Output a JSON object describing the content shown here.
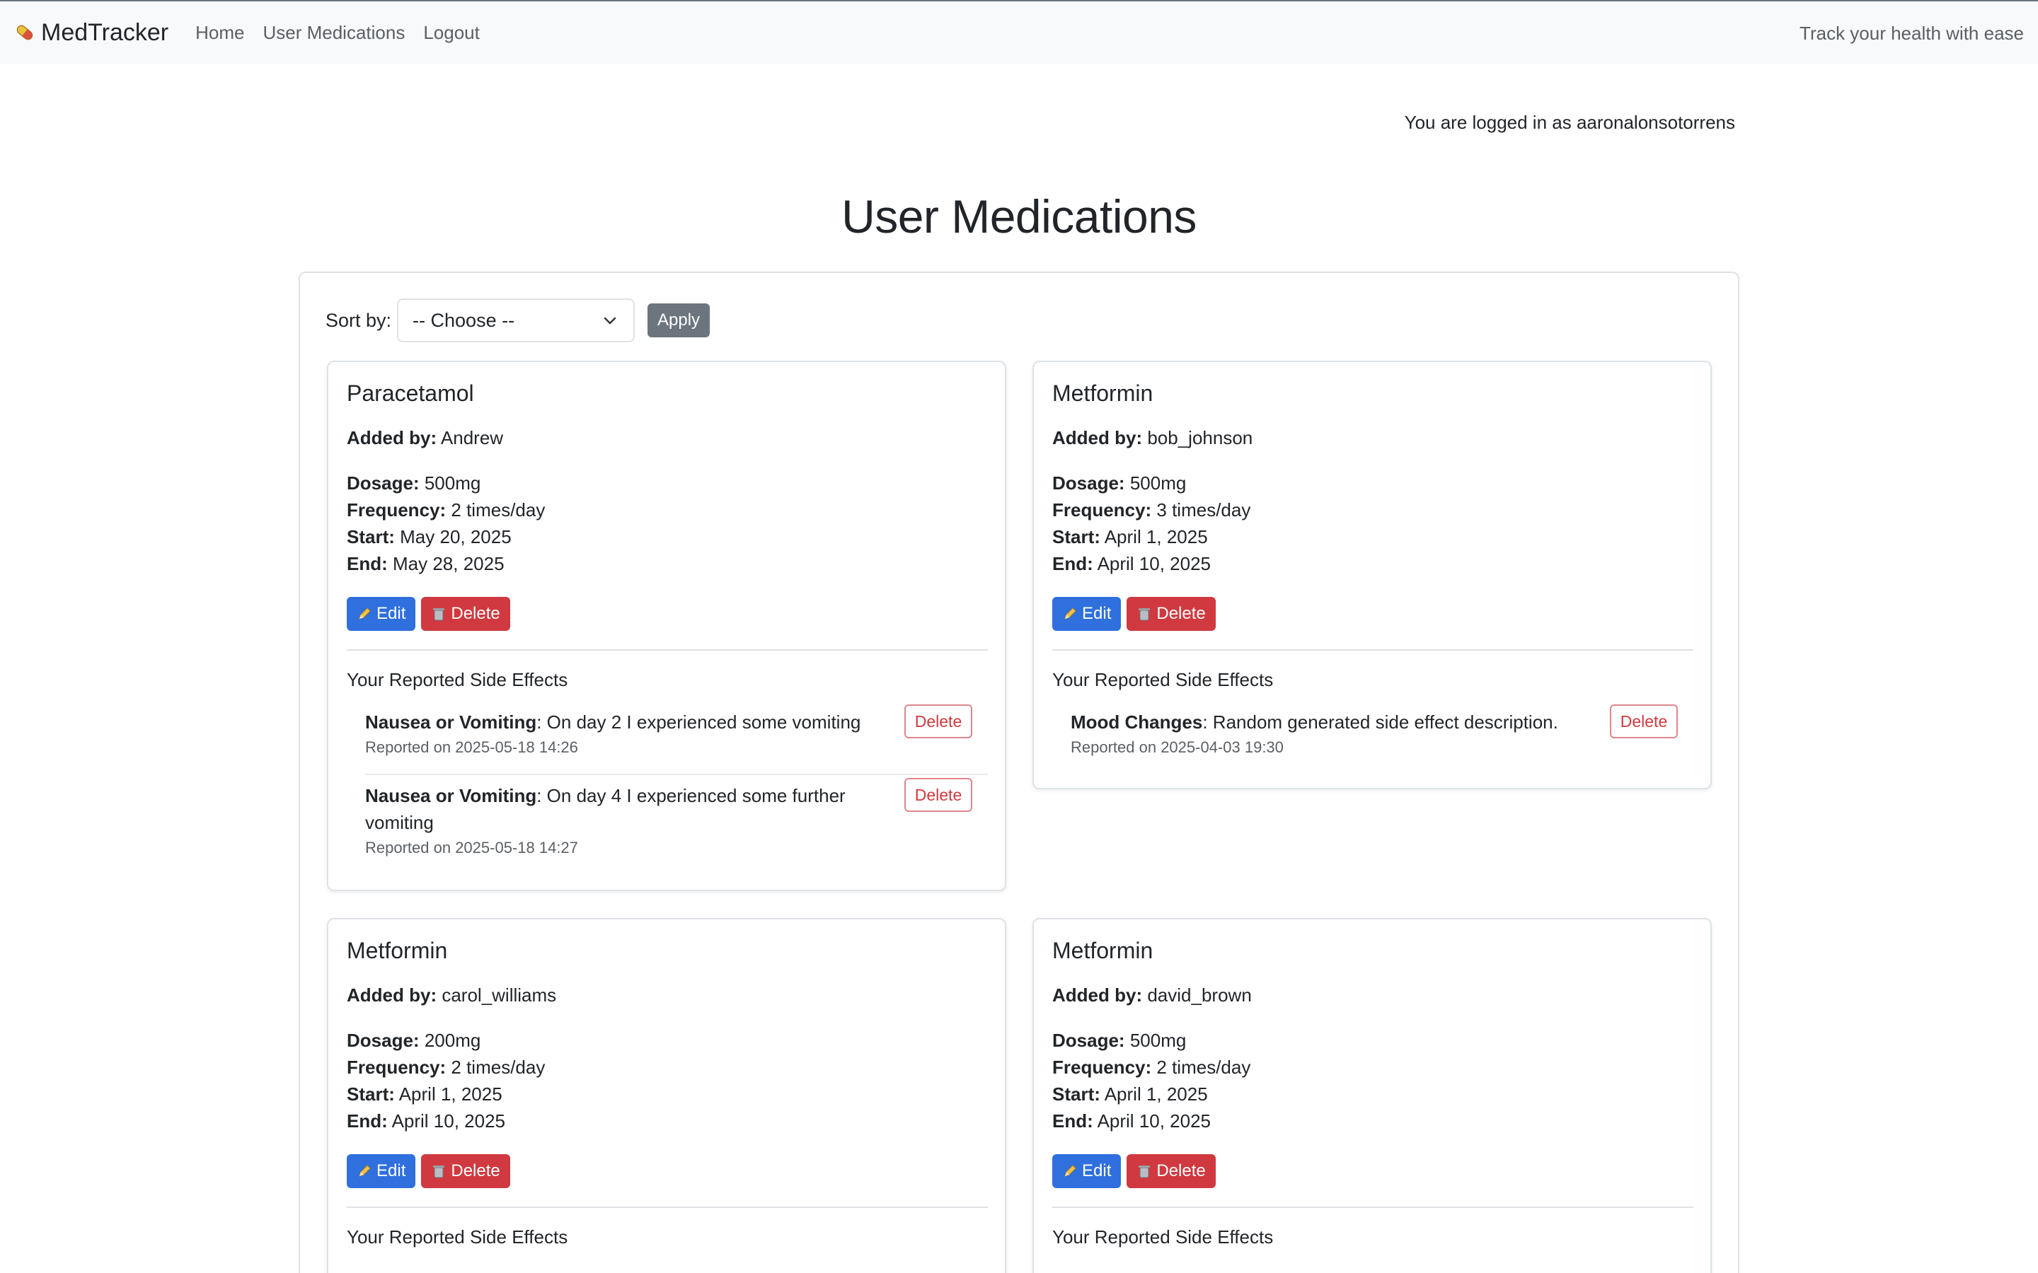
{
  "navbar": {
    "brand": "MedTracker",
    "links": [
      "Home",
      "User Medications",
      "Logout"
    ],
    "tagline": "Track your health with ease"
  },
  "login_info": "You are logged in as aaronalonsotorrens",
  "page_title": "User Medications",
  "sort": {
    "label": "Sort by:",
    "selected": "-- Choose --",
    "apply_label": "Apply"
  },
  "labels": {
    "added_by": "Added by:",
    "dosage": "Dosage:",
    "frequency": "Frequency:",
    "start": "Start:",
    "end": "End:",
    "edit": "Edit",
    "delete": "Delete",
    "side_effects_title": "Your Reported Side Effects",
    "se_delete": "Delete"
  },
  "colors": {
    "edit_button": "#2f6fde",
    "delete_button": "#d0393f",
    "apply_button": "#6c757d"
  },
  "icons": {
    "brand": "pill-icon",
    "edit": "pencil-icon",
    "delete": "trash-icon",
    "select": "chevron-down-icon"
  },
  "medications": [
    {
      "name": "Paracetamol",
      "added_by": "Andrew",
      "dosage": "500mg",
      "frequency": "2 times/day",
      "start": "May 20, 2025",
      "end": "May 28, 2025",
      "side_effects": [
        {
          "type": "Nausea or Vomiting",
          "text": ": On day 2 I experienced some vomiting",
          "date": "Reported on 2025-05-18 14:26"
        },
        {
          "type": "Nausea or Vomiting",
          "text": ": On day 4 I experienced some further vomiting",
          "date": "Reported on 2025-05-18 14:27"
        }
      ]
    },
    {
      "name": "Metformin",
      "added_by": "bob_johnson",
      "dosage": "500mg",
      "frequency": "3 times/day",
      "start": "April 1, 2025",
      "end": "April 10, 2025",
      "side_effects": [
        {
          "type": "Mood Changes",
          "text": ": Random generated side effect description.",
          "date": "Reported on 2025-04-03 19:30"
        }
      ]
    },
    {
      "name": "Metformin",
      "added_by": "carol_williams",
      "dosage": "200mg",
      "frequency": "2 times/day",
      "start": "April 1, 2025",
      "end": "April 10, 2025",
      "side_effects": []
    },
    {
      "name": "Metformin",
      "added_by": "david_brown",
      "dosage": "500mg",
      "frequency": "2 times/day",
      "start": "April 1, 2025",
      "end": "April 10, 2025",
      "side_effects": []
    }
  ]
}
